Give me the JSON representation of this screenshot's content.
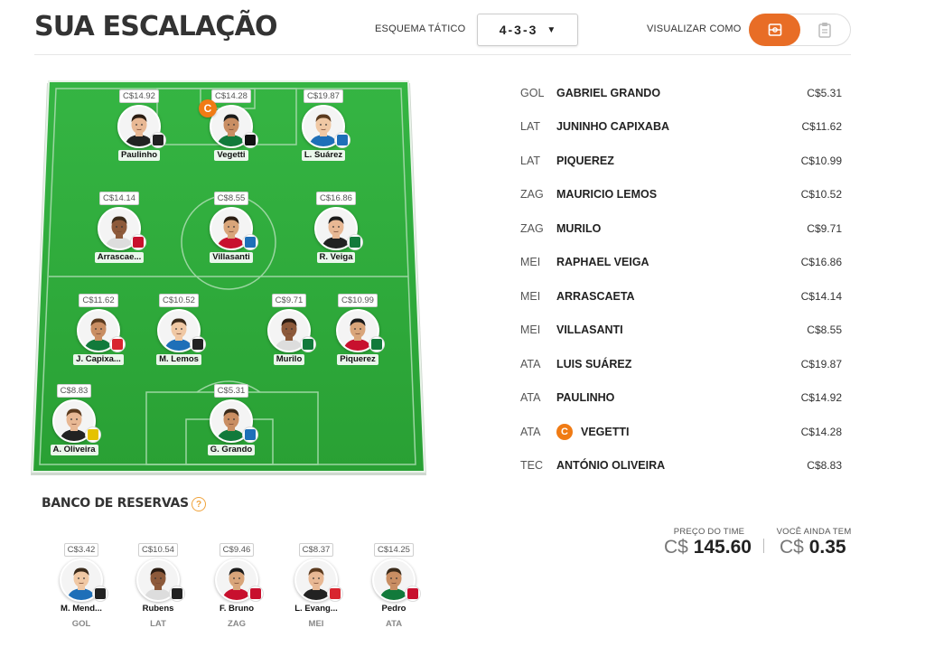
{
  "header": {
    "title": "SUA ESCALAÇÃO",
    "formation_label": "ESQUEMA TÁTICO",
    "formation_value": "4-3-3",
    "view_label": "VISUALIZAR COMO"
  },
  "colors": {
    "accent": "#e86d26",
    "captain": "#f07b14",
    "pitch": "#2eaa3c"
  },
  "field_players": [
    {
      "name": "Paulinho",
      "price": "C$14.92",
      "crest": "#222222"
    },
    {
      "name": "Vegetti",
      "price": "C$14.28",
      "crest": "#111111",
      "captain": "C"
    },
    {
      "name": "L. Suárez",
      "price": "C$19.87",
      "crest": "#1e6fb8"
    },
    {
      "name": "Arrascae...",
      "price": "C$14.14",
      "crest": "#c8102e"
    },
    {
      "name": "Villasanti",
      "price": "C$8.55",
      "crest": "#1e6fb8"
    },
    {
      "name": "R. Veiga",
      "price": "C$16.86",
      "crest": "#127a3b"
    },
    {
      "name": "J. Capixa...",
      "price": "C$11.62",
      "crest": "#d8252f"
    },
    {
      "name": "M. Lemos",
      "price": "C$10.52",
      "crest": "#222222"
    },
    {
      "name": "Murilo",
      "price": "C$9.71",
      "crest": "#127a3b"
    },
    {
      "name": "Piquerez",
      "price": "C$10.99",
      "crest": "#127a3b"
    },
    {
      "name": "A. Oliveira",
      "price": "C$8.83",
      "crest": "#e5c200"
    },
    {
      "name": "G. Grando",
      "price": "C$5.31",
      "crest": "#1e6fb8"
    }
  ],
  "lineup": [
    {
      "pos": "GOL",
      "name": "GABRIEL GRANDO",
      "price": "C$5.31"
    },
    {
      "pos": "LAT",
      "name": "JUNINHO CAPIXABA",
      "price": "C$11.62"
    },
    {
      "pos": "LAT",
      "name": "PIQUEREZ",
      "price": "C$10.99"
    },
    {
      "pos": "ZAG",
      "name": "MAURICIO LEMOS",
      "price": "C$10.52"
    },
    {
      "pos": "ZAG",
      "name": "MURILO",
      "price": "C$9.71"
    },
    {
      "pos": "MEI",
      "name": "RAPHAEL VEIGA",
      "price": "C$16.86"
    },
    {
      "pos": "MEI",
      "name": "ARRASCAETA",
      "price": "C$14.14"
    },
    {
      "pos": "MEI",
      "name": "VILLASANTI",
      "price": "C$8.55"
    },
    {
      "pos": "ATA",
      "name": "LUIS SUÁREZ",
      "price": "C$19.87"
    },
    {
      "pos": "ATA",
      "name": "PAULINHO",
      "price": "C$14.92"
    },
    {
      "pos": "ATA",
      "name": "VEGETTI",
      "price": "C$14.28",
      "captain": "C"
    },
    {
      "pos": "TEC",
      "name": "ANTÓNIO OLIVEIRA",
      "price": "C$8.83"
    }
  ],
  "bench": {
    "title": "BANCO DE RESERVAS",
    "help": "?",
    "players": [
      {
        "name": "M. Mend...",
        "pos": "GOL",
        "price": "C$3.42",
        "crest": "#222222"
      },
      {
        "name": "Rubens",
        "pos": "LAT",
        "price": "C$10.54",
        "crest": "#222222"
      },
      {
        "name": "F. Bruno",
        "pos": "ZAG",
        "price": "C$9.46",
        "crest": "#c8102e"
      },
      {
        "name": "L. Evang...",
        "pos": "MEI",
        "price": "C$8.37",
        "crest": "#d8252f"
      },
      {
        "name": "Pedro",
        "pos": "ATA",
        "price": "C$14.25",
        "crest": "#c8102e"
      }
    ]
  },
  "totals": {
    "team_price_label": "PREÇO DO TIME",
    "team_price_currency": "C$",
    "team_price_value": "145.60",
    "remaining_label": "VOCÊ AINDA TEM",
    "remaining_currency": "C$",
    "remaining_value": "0.35"
  }
}
